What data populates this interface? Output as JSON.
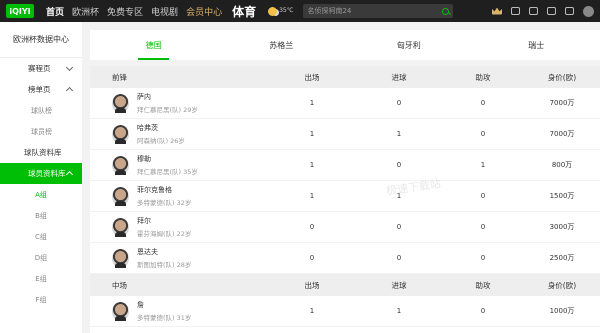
{
  "header": {
    "logo": "iQIYI",
    "nav": [
      "首页",
      "欧洲杯",
      "免费专区",
      "电视剧",
      "会员中心"
    ],
    "section": "体育",
    "weather_temp": "35℃",
    "search_placeholder": "名侦探柯南24"
  },
  "sidebar": {
    "title": "欧洲杯数据中心",
    "items": [
      {
        "label": "赛程页"
      },
      {
        "label": "榜单页"
      }
    ],
    "rank_subs": [
      "球队榜",
      "球员榜"
    ],
    "team_db": "球队资料库",
    "player_db": "球员资料库",
    "groups": [
      "A组",
      "B组",
      "C组",
      "D组",
      "E组",
      "F组"
    ]
  },
  "tabs": [
    "德国",
    "苏格兰",
    "匈牙利",
    "瑞士"
  ],
  "table": {
    "headers_fw": [
      "前锋",
      "出场",
      "进球",
      "助攻",
      "身价(欧)"
    ],
    "forwards": [
      {
        "name": "萨内",
        "club": "拜仁慕尼黑(队)",
        "age": "29岁",
        "apps": "1",
        "goals": "0",
        "assists": "0",
        "value": "7000万"
      },
      {
        "name": "哈弗茨",
        "club": "阿森纳(队)",
        "age": "26岁",
        "apps": "1",
        "goals": "1",
        "assists": "0",
        "value": "7000万"
      },
      {
        "name": "穆勒",
        "club": "拜仁慕尼黑(队)",
        "age": "35岁",
        "apps": "1",
        "goals": "0",
        "assists": "1",
        "value": "800万"
      },
      {
        "name": "菲尔克鲁格",
        "club": "多特蒙德(队)",
        "age": "32岁",
        "apps": "1",
        "goals": "1",
        "assists": "0",
        "value": "1500万"
      },
      {
        "name": "拜尔",
        "club": "霍芬海姆(队)",
        "age": "22岁",
        "apps": "0",
        "goals": "0",
        "assists": "0",
        "value": "3000万"
      },
      {
        "name": "恩达夫",
        "club": "斯图加特(队)",
        "age": "28岁",
        "apps": "0",
        "goals": "0",
        "assists": "0",
        "value": "2500万"
      }
    ],
    "headers_mf": [
      "中场",
      "出场",
      "进球",
      "助攻",
      "身价(欧)"
    ],
    "midfielders": [
      {
        "name": "詹",
        "club": "多特蒙德(队)",
        "age": "31岁",
        "apps": "1",
        "goals": "1",
        "assists": "0",
        "value": "1000万"
      }
    ]
  },
  "watermark": "极速下载站"
}
